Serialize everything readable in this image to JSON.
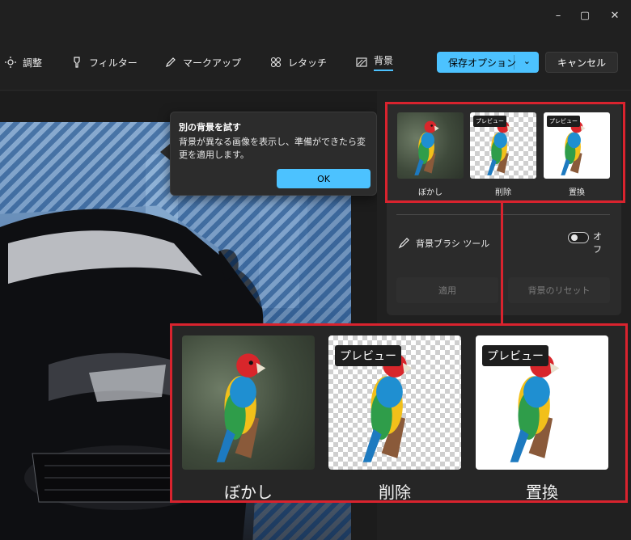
{
  "window": {
    "controls": [
      "–",
      "▢",
      "✕"
    ]
  },
  "toolbar": {
    "tabs": [
      {
        "label": "調整",
        "icon": "sun-icon"
      },
      {
        "label": "フィルター",
        "icon": "filter-icon"
      },
      {
        "label": "マークアップ",
        "icon": "pen-icon"
      },
      {
        "label": "レタッチ",
        "icon": "retouch-icon"
      },
      {
        "label": "背景",
        "icon": "background-icon",
        "active": true
      }
    ],
    "save_label": "保存オプション",
    "cancel_label": "キャンセル"
  },
  "tip": {
    "title": "別の背景を試す",
    "body": "背景が異なる画像を表示し、準備ができたら変更を適用します。",
    "ok_label": "OK"
  },
  "panel": {
    "options": [
      {
        "label": "ぼかし",
        "badge": ""
      },
      {
        "label": "削除",
        "badge": "プレビュー"
      },
      {
        "label": "置換",
        "badge": "プレビュー"
      }
    ],
    "brush_label": "背景ブラシ ツール",
    "toggle_label": "オフ",
    "apply_label": "適用",
    "reset_label": "背景のリセット"
  },
  "zoom": {
    "options": [
      {
        "label": "ぼかし",
        "badge": ""
      },
      {
        "label": "削除",
        "badge": "プレビュー"
      },
      {
        "label": "置換",
        "badge": "プレビュー"
      }
    ]
  },
  "colors": {
    "accent": "#4cc2ff",
    "highlight": "#d9232e",
    "panel_bg": "#2b2b2b"
  }
}
